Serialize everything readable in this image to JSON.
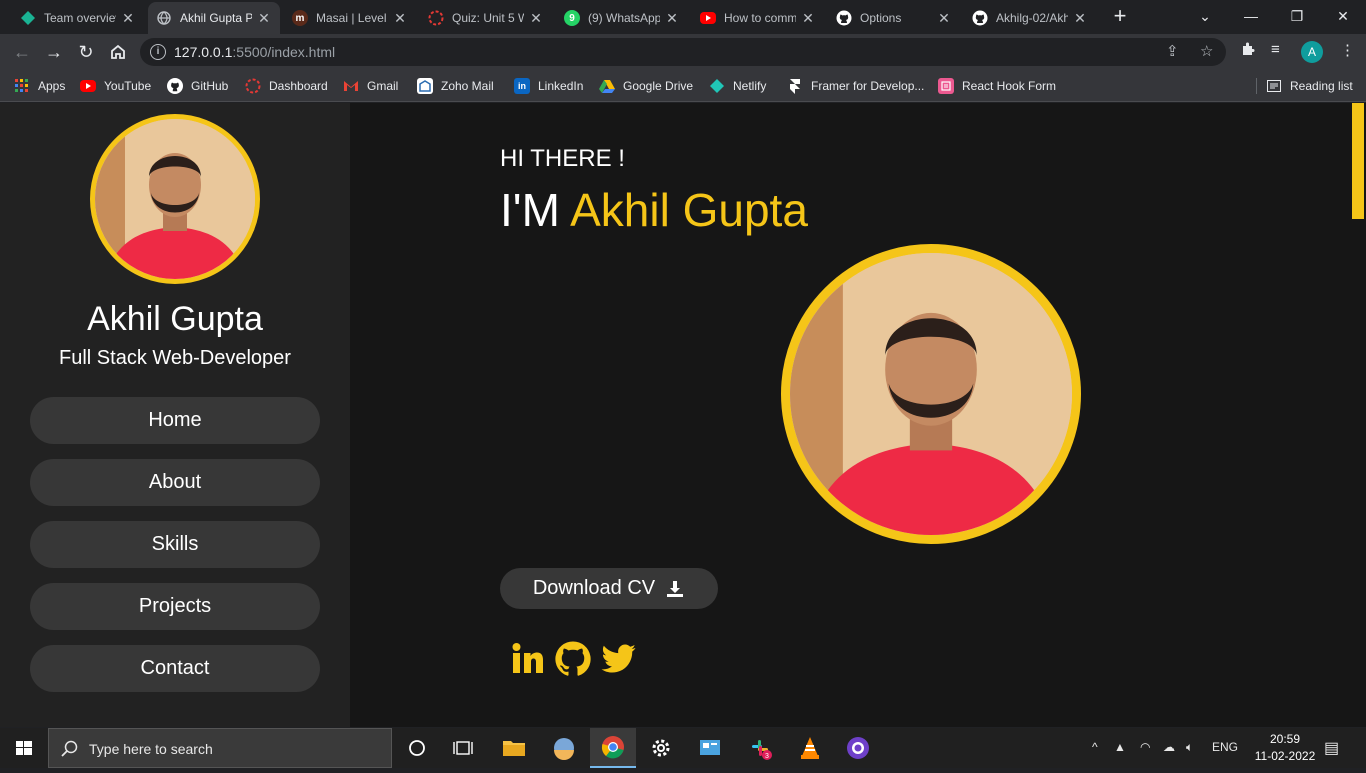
{
  "browser": {
    "tabs": [
      {
        "title": "Team overview",
        "icon_color": "#1ab394",
        "active": false
      },
      {
        "title": "Akhil Gupta P",
        "icon_color": "#9aa0a6",
        "active": true
      },
      {
        "title": "Masai | Level",
        "icon_color": "#e25b3a",
        "active": false
      },
      {
        "title": "Quiz: Unit 5 W",
        "icon_color": "#e53935",
        "active": false
      },
      {
        "title": "(9) WhatsApp",
        "icon_color": "#25d366",
        "active": false
      },
      {
        "title": "How to comm",
        "icon_color": "#ff0000",
        "active": false
      },
      {
        "title": "Options",
        "icon_color": "#ffffff",
        "active": false
      },
      {
        "title": "Akhilg-02/Akh",
        "icon_color": "#ffffff",
        "active": false
      }
    ],
    "url_host": "127.0.0.1",
    "url_path": ":5500/index.html",
    "profile_initial": "A",
    "bookmarks": [
      {
        "label": "Apps",
        "icon": "apps-grid-icon"
      },
      {
        "label": "YouTube",
        "icon": "youtube-icon"
      },
      {
        "label": "GitHub",
        "icon": "github-icon"
      },
      {
        "label": "Dashboard",
        "icon": "dashboard-icon"
      },
      {
        "label": "Gmail",
        "icon": "gmail-icon"
      },
      {
        "label": "Zoho Mail",
        "icon": "zoho-mail-icon"
      },
      {
        "label": "LinkedIn",
        "icon": "linkedin-icon"
      },
      {
        "label": "Google Drive",
        "icon": "google-drive-icon"
      },
      {
        "label": "Netlify",
        "icon": "netlify-icon"
      },
      {
        "label": "Framer for Develop...",
        "icon": "framer-icon"
      },
      {
        "label": "React Hook Form",
        "icon": "react-hook-form-icon"
      }
    ],
    "reading_list": "Reading list"
  },
  "page": {
    "sidebar": {
      "name": "Akhil Gupta",
      "role": "Full Stack Web-Developer",
      "nav": [
        "Home",
        "About",
        "Skills",
        "Projects",
        "Contact"
      ]
    },
    "main": {
      "greeting": "HI THERE !",
      "title_prefix": "I'M ",
      "title_name": "Akhil Gupta",
      "cv_button": "Download CV",
      "social": [
        "linkedin-icon",
        "github-icon",
        "twitter-icon"
      ]
    },
    "colors": {
      "accent": "#f5c518",
      "sidebar_bg": "#222222",
      "main_bg": "#161616",
      "button_bg": "#373737"
    }
  },
  "taskbar": {
    "search_placeholder": "Type here to search",
    "language": "ENG",
    "time": "20:59",
    "date": "11-02-2022",
    "slack_badge": "3"
  }
}
